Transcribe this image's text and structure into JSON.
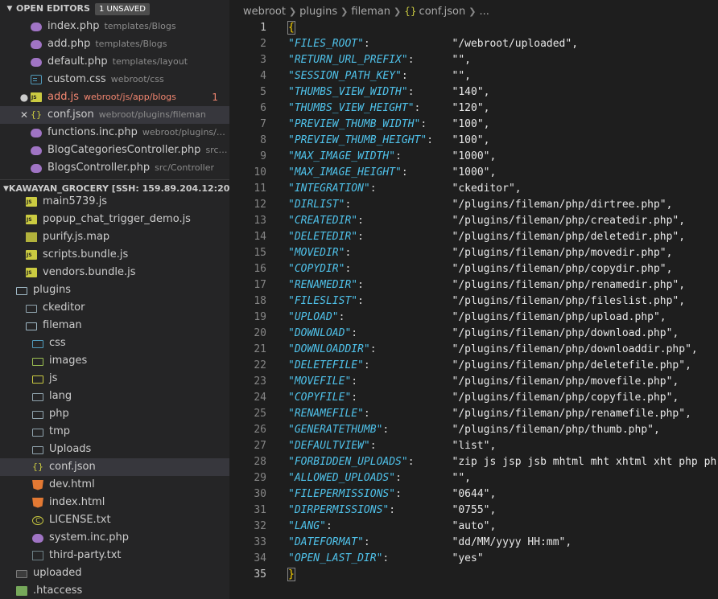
{
  "open_editors": {
    "title": "OPEN EDITORS",
    "badge": "1 UNSAVED",
    "items": [
      {
        "icon": "php",
        "name": "index.php",
        "dir": "templates/Blogs"
      },
      {
        "icon": "php",
        "name": "add.php",
        "dir": "templates/Blogs"
      },
      {
        "icon": "php",
        "name": "default.php",
        "dir": "templates/layout"
      },
      {
        "icon": "css",
        "name": "custom.css",
        "dir": "webroot/css"
      },
      {
        "icon": "js",
        "name": "add.js",
        "dir": "webroot/js/app/blogs",
        "error_count": "1",
        "unsaved": true
      },
      {
        "icon": "json",
        "name": "conf.json",
        "dir": "webroot/plugins/fileman",
        "active": true
      },
      {
        "icon": "php",
        "name": "functions.inc.php",
        "dir": "webroot/plugins/file..."
      },
      {
        "icon": "php",
        "name": "BlogCategoriesController.php",
        "dir": "src/Con..."
      },
      {
        "icon": "php",
        "name": "BlogsController.php",
        "dir": "src/Controller"
      }
    ]
  },
  "explorer": {
    "title": "KAWAYAN_GROCERY [SSH: 159.89.204.12:20]",
    "items": [
      {
        "icon": "js",
        "name": "main5739.js",
        "indent": 2
      },
      {
        "icon": "js",
        "name": "popup_chat_trigger_demo.js",
        "indent": 2
      },
      {
        "icon": "map",
        "name": "purify.js.map",
        "indent": 2
      },
      {
        "icon": "js",
        "name": "scripts.bundle.js",
        "indent": 2
      },
      {
        "icon": "js",
        "name": "vendors.bundle.js",
        "indent": 2
      },
      {
        "icon": "folder-open",
        "name": "plugins",
        "indent": 1
      },
      {
        "icon": "folder",
        "name": "ckeditor",
        "indent": 2
      },
      {
        "icon": "folder-open",
        "name": "fileman",
        "indent": 2
      },
      {
        "icon": "folder-css",
        "name": "css",
        "indent": 3
      },
      {
        "icon": "folder-img",
        "name": "images",
        "indent": 3
      },
      {
        "icon": "folder-js",
        "name": "js",
        "indent": 3
      },
      {
        "icon": "folder",
        "name": "lang",
        "indent": 3
      },
      {
        "icon": "folder",
        "name": "php",
        "indent": 3
      },
      {
        "icon": "folder",
        "name": "tmp",
        "indent": 3
      },
      {
        "icon": "folder",
        "name": "Uploads",
        "indent": 3
      },
      {
        "icon": "json",
        "name": "conf.json",
        "indent": 3,
        "selected": true
      },
      {
        "icon": "html",
        "name": "dev.html",
        "indent": 3
      },
      {
        "icon": "html",
        "name": "index.html",
        "indent": 3
      },
      {
        "icon": "license",
        "name": "LICENSE.txt",
        "indent": 3
      },
      {
        "icon": "php",
        "name": "system.inc.php",
        "indent": 3
      },
      {
        "icon": "txt",
        "name": "third-party.txt",
        "indent": 3
      },
      {
        "icon": "folder-dark",
        "name": "uploaded",
        "indent": 1
      },
      {
        "icon": "htaccess",
        "name": ".htaccess",
        "indent": 1
      }
    ]
  },
  "breadcrumb": {
    "parts": [
      "webroot",
      "plugins",
      "fileman"
    ],
    "file": "conf.json",
    "tail": "..."
  },
  "editor": {
    "entries": [
      {
        "k": "\"FILES_ROOT\"",
        "v": "\"/webroot/uploaded\","
      },
      {
        "k": "\"RETURN_URL_PREFIX\"",
        "v": "\"\","
      },
      {
        "k": "\"SESSION_PATH_KEY\"",
        "v": "\"\","
      },
      {
        "k": "\"THUMBS_VIEW_WIDTH\"",
        "v": "\"140\","
      },
      {
        "k": "\"THUMBS_VIEW_HEIGHT\"",
        "v": "\"120\","
      },
      {
        "k": "\"PREVIEW_THUMB_WIDTH\"",
        "v": "\"100\","
      },
      {
        "k": "\"PREVIEW_THUMB_HEIGHT\"",
        "v": "\"100\","
      },
      {
        "k": "\"MAX_IMAGE_WIDTH\"",
        "v": "\"1000\","
      },
      {
        "k": "\"MAX_IMAGE_HEIGHT\"",
        "v": "\"1000\","
      },
      {
        "k": "\"INTEGRATION\"",
        "v": "\"ckeditor\","
      },
      {
        "k": "\"DIRLIST\"",
        "v": "\"/plugins/fileman/php/dirtree.php\","
      },
      {
        "k": "\"CREATEDIR\"",
        "v": "\"/plugins/fileman/php/createdir.php\","
      },
      {
        "k": "\"DELETEDIR\"",
        "v": "\"/plugins/fileman/php/deletedir.php\","
      },
      {
        "k": "\"MOVEDIR\"",
        "v": "\"/plugins/fileman/php/movedir.php\","
      },
      {
        "k": "\"COPYDIR\"",
        "v": "\"/plugins/fileman/php/copydir.php\","
      },
      {
        "k": "\"RENAMEDIR\"",
        "v": "\"/plugins/fileman/php/renamedir.php\","
      },
      {
        "k": "\"FILESLIST\"",
        "v": "\"/plugins/fileman/php/fileslist.php\","
      },
      {
        "k": "\"UPLOAD\"",
        "v": "\"/plugins/fileman/php/upload.php\","
      },
      {
        "k": "\"DOWNLOAD\"",
        "v": "\"/plugins/fileman/php/download.php\","
      },
      {
        "k": "\"DOWNLOADDIR\"",
        "v": "\"/plugins/fileman/php/downloaddir.php\","
      },
      {
        "k": "\"DELETEFILE\"",
        "v": "\"/plugins/fileman/php/deletefile.php\","
      },
      {
        "k": "\"MOVEFILE\"",
        "v": "\"/plugins/fileman/php/movefile.php\","
      },
      {
        "k": "\"COPYFILE\"",
        "v": "\"/plugins/fileman/php/copyfile.php\","
      },
      {
        "k": "\"RENAMEFILE\"",
        "v": "\"/plugins/fileman/php/renamefile.php\","
      },
      {
        "k": "\"GENERATETHUMB\"",
        "v": "\"/plugins/fileman/php/thumb.php\","
      },
      {
        "k": "\"DEFAULTVIEW\"",
        "v": "\"list\","
      },
      {
        "k": "\"FORBIDDEN_UPLOADS\"",
        "v": "\"zip js jsp jsb mhtml mht xhtml xht php ph"
      },
      {
        "k": "\"ALLOWED_UPLOADS\"",
        "v": "\"\","
      },
      {
        "k": "\"FILEPERMISSIONS\"",
        "v": "\"0644\","
      },
      {
        "k": "\"DIRPERMISSIONS\"",
        "v": "\"0755\","
      },
      {
        "k": "\"LANG\"",
        "v": "\"auto\","
      },
      {
        "k": "\"DATEFORMAT\"",
        "v": "\"dd/MM/yyyy HH:mm\","
      },
      {
        "k": "\"OPEN_LAST_DIR\"",
        "v": "\"yes\""
      }
    ],
    "open_brace": "{",
    "close_brace": "}",
    "colon": ":",
    "line_numbers": [
      "1",
      "2",
      "3",
      "4",
      "5",
      "6",
      "7",
      "8",
      "9",
      "10",
      "11",
      "12",
      "13",
      "14",
      "15",
      "16",
      "17",
      "18",
      "19",
      "20",
      "21",
      "22",
      "23",
      "24",
      "25",
      "26",
      "27",
      "28",
      "29",
      "30",
      "31",
      "32",
      "33",
      "34",
      "35"
    ]
  },
  "colors": {
    "accent": "#4fc1e9",
    "error": "#f48771",
    "selection": "#37373d"
  }
}
